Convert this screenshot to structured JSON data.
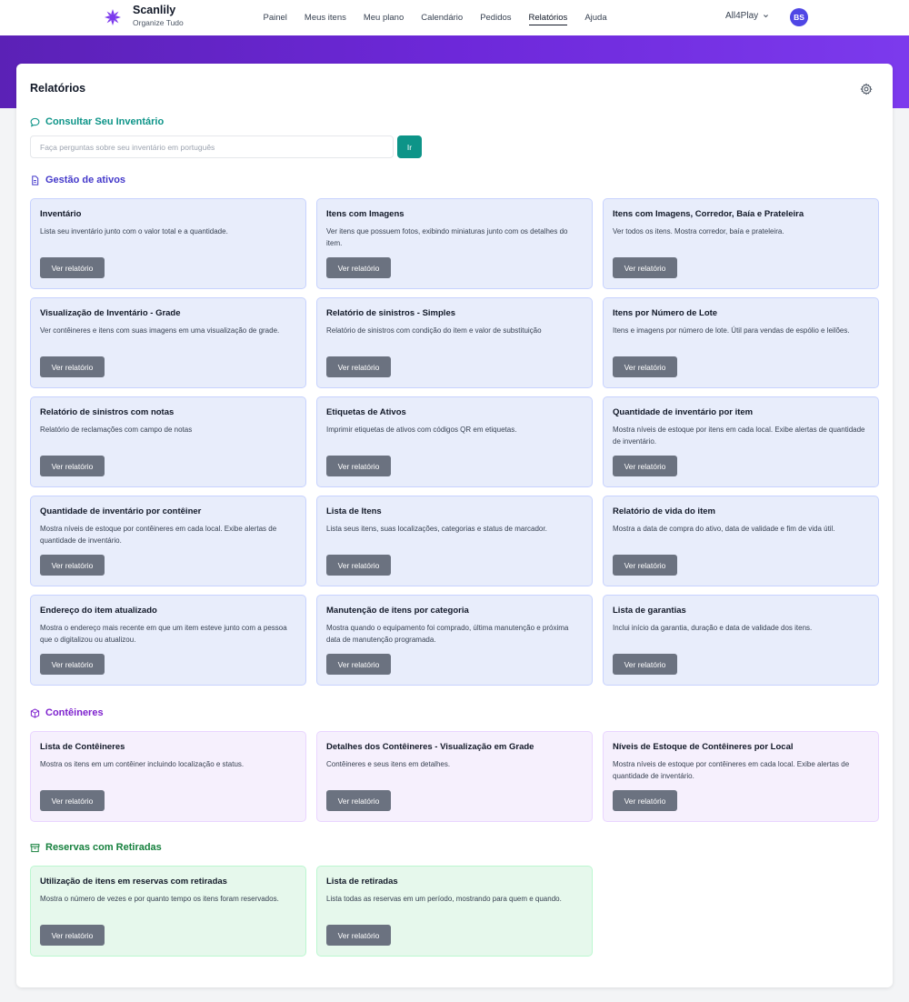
{
  "app": {
    "name": "Scanlily",
    "tagline": "Organize Tudo",
    "workspace": "All4Play",
    "avatar_initials": "BS"
  },
  "nav": {
    "items": [
      {
        "label": "Painel"
      },
      {
        "label": "Meus itens"
      },
      {
        "label": "Meu plano"
      },
      {
        "label": "Calendário"
      },
      {
        "label": "Pedidos"
      },
      {
        "label": "Relatórios",
        "active": true
      },
      {
        "label": "Ajuda"
      }
    ]
  },
  "page": {
    "title": "Relatórios"
  },
  "query": {
    "title": "Consultar Seu Inventário",
    "placeholder": "Faça perguntas sobre seu inventário em português",
    "value": "",
    "button_label": "Ir"
  },
  "sections": {
    "assets": {
      "title": "Gestão de ativos",
      "color": "#4338ca",
      "cards": [
        {
          "title": "Inventário",
          "desc": "Lista seu inventário junto com o valor total e a quantidade.",
          "button": "Ver relatório"
        },
        {
          "title": "Itens com Imagens",
          "desc": "Ver itens que possuem fotos, exibindo miniaturas junto com os detalhes do item.",
          "button": "Ver relatório"
        },
        {
          "title": "Itens com Imagens, Corredor, Baía e Prateleira",
          "desc": "Ver todos os itens. Mostra corredor, baía e prateleira.",
          "button": "Ver relatório"
        },
        {
          "title": "Visualização de Inventário - Grade",
          "desc": "Ver contêineres e itens com suas imagens em uma visualização de grade.",
          "button": "Ver relatório"
        },
        {
          "title": "Relatório de sinistros - Simples",
          "desc": "Relatório de sinistros com condição do item e valor de substituição",
          "button": "Ver relatório"
        },
        {
          "title": "Itens por Número de Lote",
          "desc": "Itens e imagens por número de lote. Útil para vendas de espólio e leilões.",
          "button": "Ver relatório"
        },
        {
          "title": "Relatório de sinistros com notas",
          "desc": "Relatório de reclamações com campo de notas",
          "button": "Ver relatório"
        },
        {
          "title": "Etiquetas de Ativos",
          "desc": "Imprimir etiquetas de ativos com códigos QR em etiquetas.",
          "button": "Ver relatório"
        },
        {
          "title": "Quantidade de inventário por item",
          "desc": "Mostra níveis de estoque por itens em cada local. Exibe alertas de quantidade de inventário.",
          "button": "Ver relatório"
        },
        {
          "title": "Quantidade de inventário por contêiner",
          "desc": "Mostra níveis de estoque por contêineres em cada local. Exibe alertas de quantidade de inventário.",
          "button": "Ver relatório"
        },
        {
          "title": "Lista de Itens",
          "desc": "Lista seus itens, suas localizações, categorias e status de marcador.",
          "button": "Ver relatório"
        },
        {
          "title": "Relatório de vida do item",
          "desc": "Mostra a data de compra do ativo, data de validade e fim de vida útil.",
          "button": "Ver relatório"
        },
        {
          "title": "Endereço do item atualizado",
          "desc": "Mostra o endereço mais recente em que um item esteve junto com a pessoa que o digitalizou ou atualizou.",
          "button": "Ver relatório"
        },
        {
          "title": "Manutenção de itens por categoria",
          "desc": "Mostra quando o equipamento foi comprado, última manutenção e próxima data de manutenção programada.",
          "button": "Ver relatório"
        },
        {
          "title": "Lista de garantias",
          "desc": "Inclui início da garantia, duração e data de validade dos itens.",
          "button": "Ver relatório"
        }
      ]
    },
    "containers": {
      "title": "Contêineres",
      "color": "#7e22ce",
      "cards": [
        {
          "title": "Lista de Contêineres",
          "desc": "Mostra os itens em um contêiner incluindo localização e status.",
          "button": "Ver relatório"
        },
        {
          "title": "Detalhes dos Contêineres - Visualização em Grade",
          "desc": "Contêineres e seus itens em detalhes.",
          "button": "Ver relatório"
        },
        {
          "title": "Níveis de Estoque de Contêineres por Local",
          "desc": "Mostra níveis de estoque por contêineres em cada local. Exibe alertas de quantidade de inventário.",
          "button": "Ver relatório"
        }
      ]
    },
    "reservations": {
      "title": "Reservas com Retiradas",
      "color": "#15803d",
      "cards": [
        {
          "title": "Utilização de itens em reservas com retiradas",
          "desc": "Mostra o número de vezes e por quanto tempo os itens foram reservados.",
          "button": "Ver relatório"
        },
        {
          "title": "Lista de retiradas",
          "desc": "Lista todas as reservas em um período, mostrando para quem e quando.",
          "button": "Ver relatório"
        }
      ]
    }
  },
  "colors": {
    "accent": "#0d9488",
    "brand": "#6d28d9"
  }
}
